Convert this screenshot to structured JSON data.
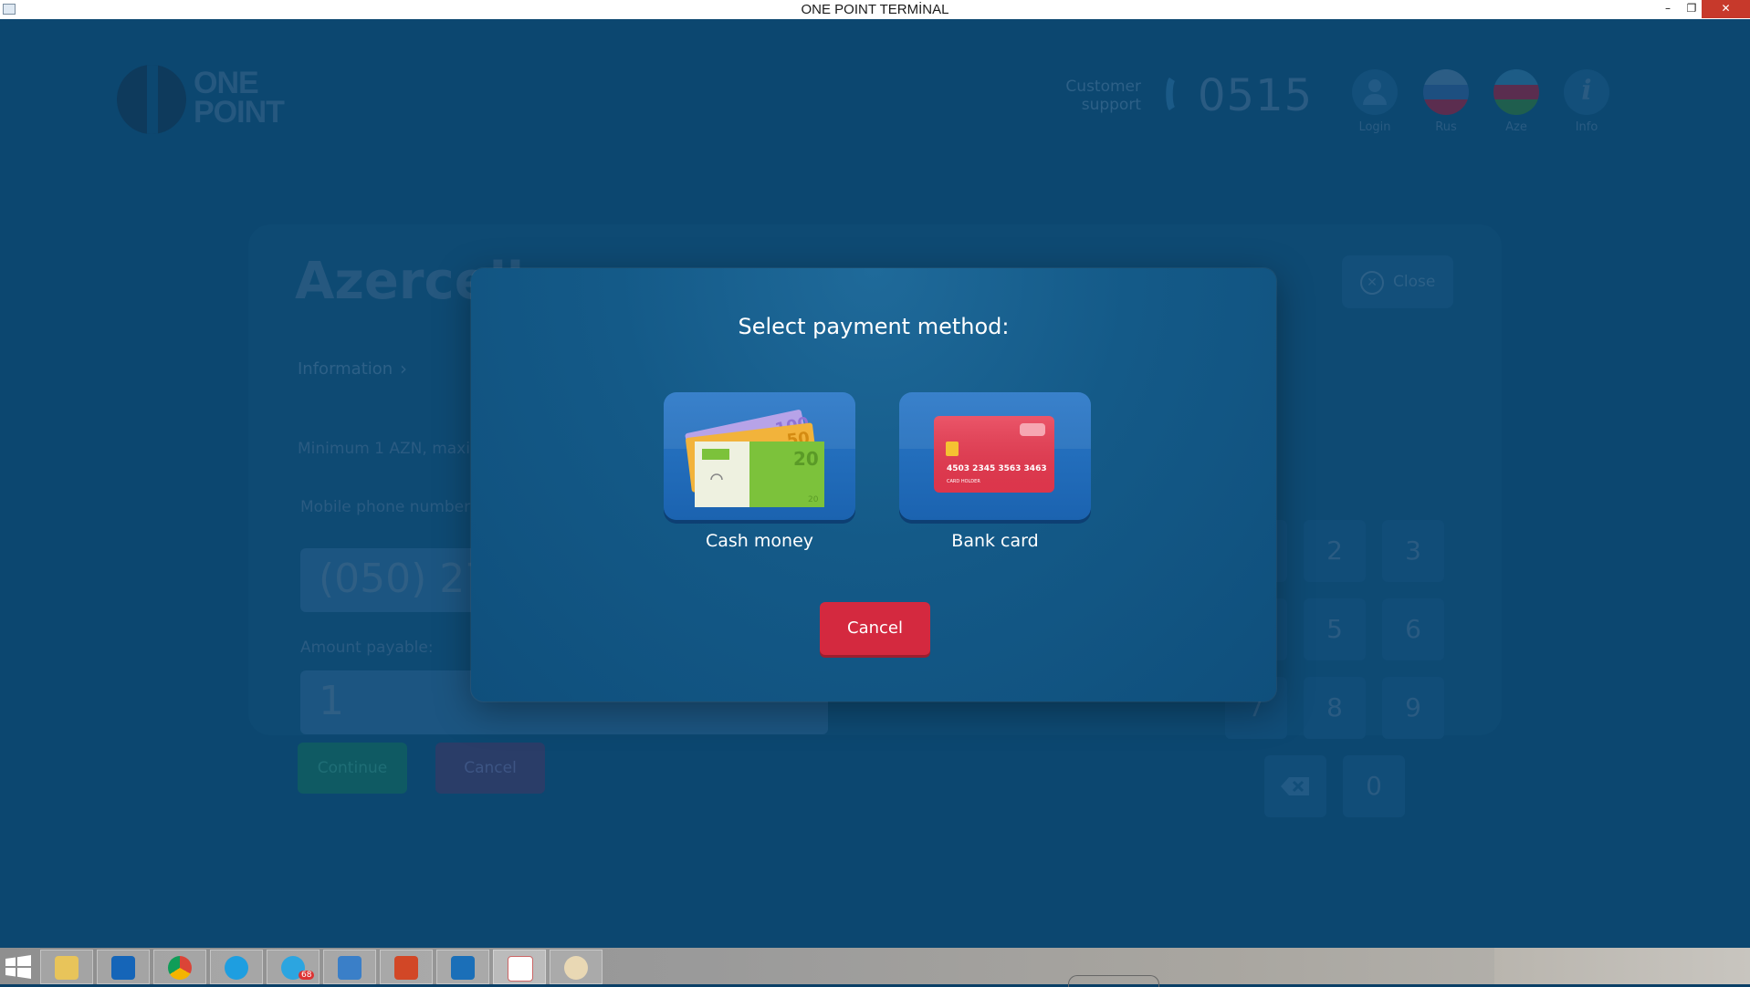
{
  "window": {
    "title": "ONE POINT TERMİNAL",
    "minimize": "–",
    "maximize": "❐",
    "close": "✕"
  },
  "header": {
    "logo_text_1": "ONE",
    "logo_text_2": "POINT",
    "support_line1": "Customer",
    "support_line2": "support",
    "phone_number": "0515",
    "login_label": "Login",
    "rus_label": "Rus",
    "aze_label": "Aze",
    "info_label": "Info"
  },
  "background_form": {
    "provider_title": "Azercell",
    "close_label": "Close",
    "breadcrumb": "Information",
    "limits_hint": "Minimum 1 AZN, maximum",
    "phone_label": "Mobile phone number",
    "phone_value": "(050) 27",
    "amount_label": "Amount payable:",
    "amount_value": "1",
    "continue_label": "Continue",
    "cancel_label": "Cancel",
    "keypad": [
      "2",
      "3",
      "5",
      "6",
      "7",
      "8",
      "9",
      "0"
    ]
  },
  "modal": {
    "title": "Select payment method:",
    "cash_label": "Cash money",
    "card_label": "Bank card",
    "card_number": "4503 2345 3563 3463",
    "card_holder": "CARD HOLDER",
    "banknote_values": [
      "100",
      "50",
      "20",
      "20"
    ],
    "cancel_label": "Cancel"
  },
  "taskbar": {
    "telegram_badge": "68",
    "apps": [
      "file-explorer",
      "outlook",
      "chrome",
      "skype",
      "telegram",
      "tool-app",
      "office-app",
      "jetbrains-app",
      "java-app",
      "paint-app"
    ]
  },
  "colors": {
    "background": "#0c4770",
    "modal": "#145a88",
    "method_tile": "#2a78c7",
    "cancel": "#d4293f",
    "card": "#e8384f"
  }
}
